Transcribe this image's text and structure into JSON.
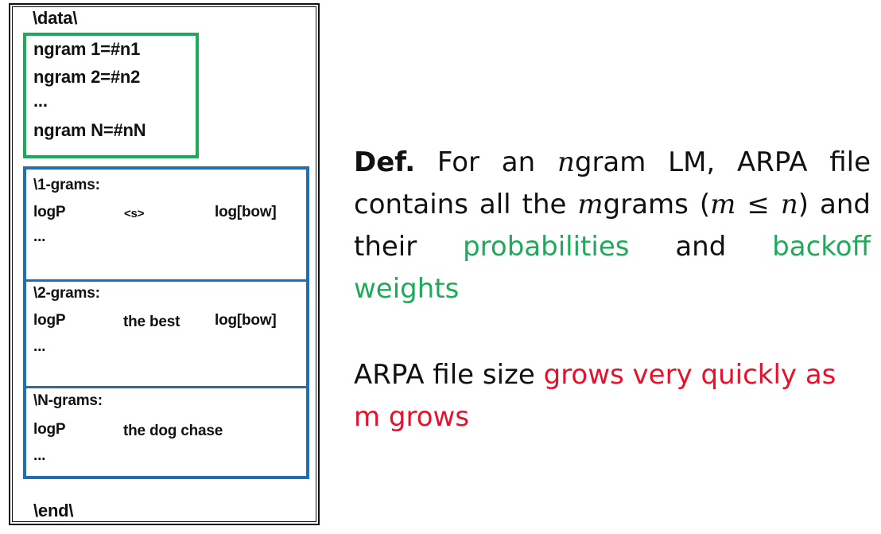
{
  "diagram": {
    "file": {
      "data_marker": "\\data\\",
      "header_lines": [
        "ngram 1=#n1",
        "ngram 2=#n2",
        "...",
        "ngram N=#nN"
      ],
      "sections": [
        {
          "heading": "\\1-grams:",
          "col_logp": "logP",
          "col_gram": "<s>",
          "col_bow": "log[bow]",
          "ellipsis": "..."
        },
        {
          "heading": "\\2-grams:",
          "col_logp": "logP",
          "col_gram": "the best",
          "col_bow": "log[bow]",
          "ellipsis": "..."
        },
        {
          "heading": "\\N-grams:",
          "col_logp": "logP",
          "col_gram": "the dog chase",
          "ellipsis": "..."
        }
      ],
      "end_marker": "\\end\\"
    },
    "colors": {
      "header_box": "#1faa5b",
      "ngram_box": "#1f6fb2",
      "highlight_green": "#1faa5b",
      "highlight_red": "#e8102a"
    }
  },
  "explanation": {
    "def_label": "Def.",
    "p1_a": " For an ",
    "var_n": "n",
    "p1_b": "gram LM, ARPA file contains all the ",
    "var_m": "m",
    "p1_c": "grams (",
    "leq": " ≤ ",
    "p1_d": ") and their ",
    "probabilities": "probabilities",
    "p1_e": " and ",
    "backoff_weights": "backoff weights",
    "p2_a": "ARPA file size ",
    "grows": "grows very quickly as",
    "p2_b": " grows"
  }
}
